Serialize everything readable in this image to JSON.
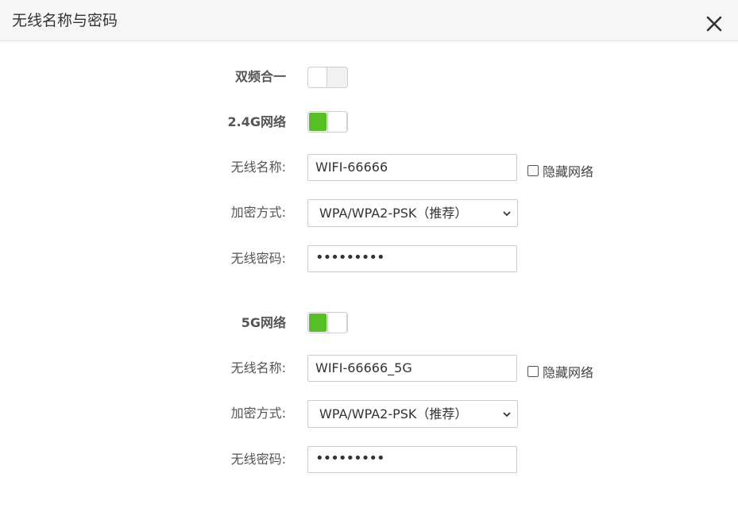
{
  "dialog": {
    "title": "无线名称与密码",
    "close_icon": "close-icon"
  },
  "dual_band": {
    "label": "双频合一",
    "enabled": false
  },
  "band_24g": {
    "label": "2.4G网络",
    "enabled": true,
    "ssid_label": "无线名称:",
    "ssid_value": "WIFI-66666",
    "hide_label": "隐藏网络",
    "hide_checked": false,
    "encryption_label": "加密方式:",
    "encryption_value": "WPA/WPA2-PSK（推荐）",
    "password_label": "无线密码:",
    "password_value": "•••••••••"
  },
  "band_5g": {
    "label": "5G网络",
    "enabled": true,
    "ssid_label": "无线名称:",
    "ssid_value": "WIFI-66666_5G",
    "hide_label": "隐藏网络",
    "hide_checked": false,
    "encryption_label": "加密方式:",
    "encryption_value": "WPA/WPA2-PSK（推荐）",
    "password_label": "无线密码:",
    "password_value": "•••••••••"
  },
  "colors": {
    "toggle_on": "#55bf24",
    "header_bg": "#f6f6f6",
    "border": "#cccccc"
  }
}
